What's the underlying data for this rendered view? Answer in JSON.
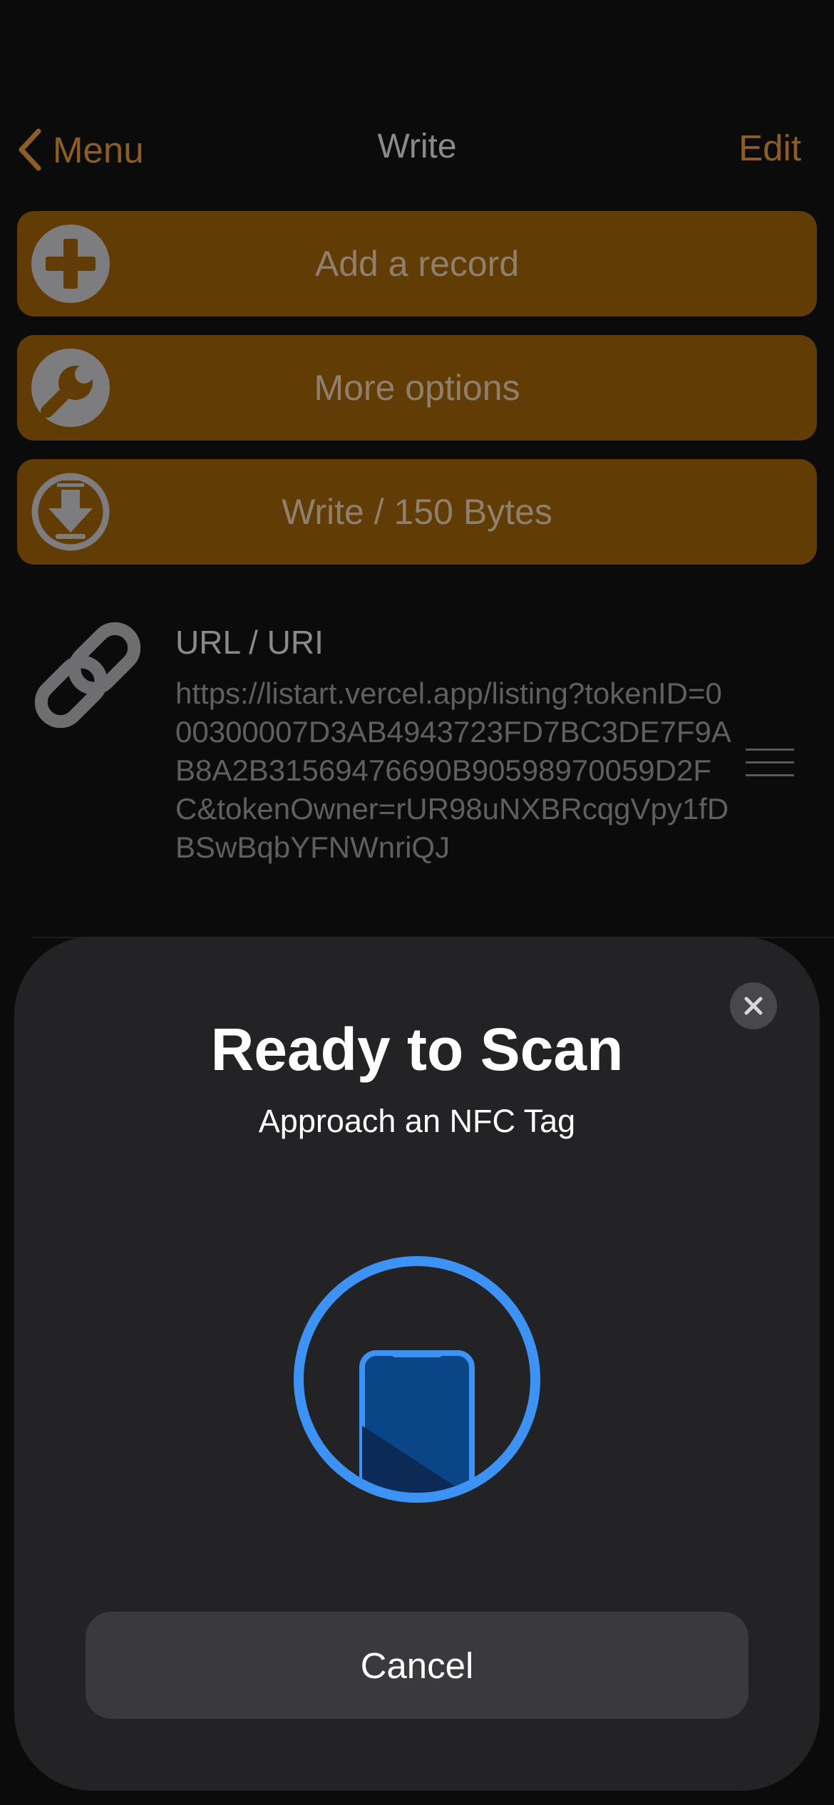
{
  "nav": {
    "back_label": "Menu",
    "title": "Write",
    "edit_label": "Edit"
  },
  "actions": [
    {
      "label": "Add a record",
      "icon": "plus-circle-icon"
    },
    {
      "label": "More options",
      "icon": "wrench-circle-icon"
    },
    {
      "label": "Write / 150 Bytes",
      "icon": "download-circle-icon"
    }
  ],
  "record": {
    "type_label": "URL / URI",
    "value": "https://listart.vercel.app/listing?tokenID=000300007D3AB4943723FD7BC3DE7F9AB8A2B31569476690B90598970059D2FC&tokenOwner=rUR98uNXBRcqgVpy1fDBSwBqbYFNWnriQJ",
    "icon": "link-icon"
  },
  "scan_sheet": {
    "title": "Ready to Scan",
    "subtitle": "Approach an NFC Tag",
    "cancel_label": "Cancel"
  },
  "colors": {
    "accent": "#8c5e22",
    "action_bg": "#613c05",
    "scan_blue": "#3d93f5"
  }
}
